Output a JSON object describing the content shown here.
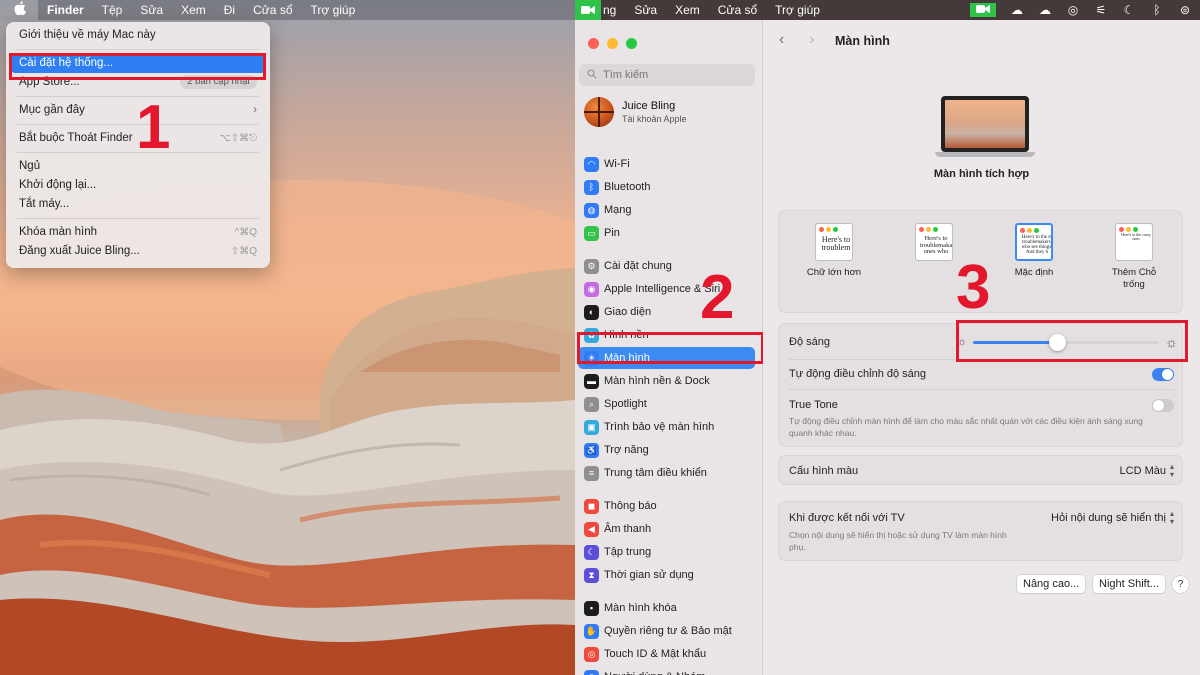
{
  "menubar_left": {
    "app_name": "Finder",
    "items": [
      "Tệp",
      "Sửa",
      "Xem",
      "Đi",
      "Cửa sổ",
      "Trợ giúp"
    ]
  },
  "menubar_right": {
    "items": [
      "ng",
      "Sửa",
      "Xem",
      "Cửa sổ",
      "Trợ giúp"
    ]
  },
  "apple_menu": {
    "about": "Giới thiệu về máy Mac này",
    "system_settings": "Cài đặt hệ thống...",
    "app_store": "App Store...",
    "app_store_badge": "2 bản cập nhật",
    "recent_items": "Mục gần đây",
    "force_quit": "Bắt buộc Thoát Finder",
    "force_quit_shortcut": "⌥⇧⌘⎋",
    "sleep": "Ngủ",
    "restart": "Khởi động lại...",
    "shut_down": "Tắt máy...",
    "lock_screen": "Khóa màn hình",
    "lock_screen_shortcut": "^⌘Q",
    "log_out": "Đăng xuất Juice Bling...",
    "log_out_shortcut": "⇧⌘Q"
  },
  "annotations": {
    "step1": "1",
    "step2": "2",
    "step3": "3"
  },
  "sidebar": {
    "search_placeholder": "Tìm kiếm",
    "account_name": "Juice Bling",
    "account_sub": "Tài khoản Apple",
    "items": [
      {
        "label": "Wi-Fi",
        "icon": "wifi-icon",
        "color": "#2f7cf6"
      },
      {
        "label": "Bluetooth",
        "icon": "bluetooth-icon",
        "color": "#2f7cf6"
      },
      {
        "label": "Mạng",
        "icon": "globe-icon",
        "color": "#2f7cf6"
      },
      {
        "label": "Pin",
        "icon": "battery-icon",
        "color": "#33c24d"
      },
      {
        "label": "Cài đặt chung",
        "icon": "gear-icon",
        "color": "#8e8e93"
      },
      {
        "label": "Apple Intelligence & Siri",
        "icon": "siri-icon",
        "color": "#c36be0"
      },
      {
        "label": "Giao diện",
        "icon": "appearance-icon",
        "color": "#1c1c1e"
      },
      {
        "label": "Hình nền",
        "icon": "wallpaper-icon",
        "color": "#34aadc"
      },
      {
        "label": "Màn hình",
        "icon": "display-icon",
        "color": "#2f7cf6"
      },
      {
        "label": "Màn hình nền & Dock",
        "icon": "dock-icon",
        "color": "#1c1c1e"
      },
      {
        "label": "Spotlight",
        "icon": "spotlight-icon",
        "color": "#8e8e93"
      },
      {
        "label": "Trình bảo vệ màn hình",
        "icon": "screensaver-icon",
        "color": "#34aadc"
      },
      {
        "label": "Trợ năng",
        "icon": "accessibility-icon",
        "color": "#2f7cf6"
      },
      {
        "label": "Trung tâm điều khiển",
        "icon": "control-center-icon",
        "color": "#8e8e93"
      },
      {
        "label": "Thông báo",
        "icon": "notification-icon",
        "color": "#f0493e"
      },
      {
        "label": "Âm thanh",
        "icon": "sound-icon",
        "color": "#f0493e"
      },
      {
        "label": "Tập trung",
        "icon": "focus-icon",
        "color": "#5b4fd9"
      },
      {
        "label": "Thời gian sử dụng",
        "icon": "hourglass-icon",
        "color": "#5b4fd9"
      },
      {
        "label": "Màn hình khóa",
        "icon": "lock-icon",
        "color": "#1c1c1e"
      },
      {
        "label": "Quyền riêng tư & Bảo mật",
        "icon": "hand-icon",
        "color": "#2f7cf6"
      },
      {
        "label": "Touch ID & Mật khẩu",
        "icon": "fingerprint-icon",
        "color": "#f0493e"
      },
      {
        "label": "Người dùng & Nhóm",
        "icon": "users-icon",
        "color": "#2f7cf6"
      }
    ]
  },
  "main": {
    "title": "Màn hình",
    "display_name": "Màn hình tích hợp",
    "resolution_options": [
      {
        "label": "Chữ lớn hơn",
        "preview": "Here's to troublem"
      },
      {
        "label": "",
        "preview": "Here's to troublemaka ones who"
      },
      {
        "label": "Mặc định",
        "preview": "Here's to the m troublemakers. who see things. And they h"
      },
      {
        "label": "Thêm Chỗ trống",
        "preview": "Here's to the crazy ones"
      }
    ],
    "brightness_label": "Độ sáng",
    "brightness_value": 0.45,
    "auto_brightness_label": "Tự động điều chỉnh độ sáng",
    "auto_brightness_on": true,
    "true_tone_label": "True Tone",
    "true_tone_desc": "Tự động điều chỉnh màn hình để làm cho màu sắc nhất quán với các điều kiện ánh sáng xung quanh khác nhau.",
    "true_tone_on": false,
    "color_profile_label": "Cấu hình màu",
    "color_profile_value": "LCD Màu",
    "tv_label": "Khi được kết nối với TV",
    "tv_value": "Hỏi nội dung sẽ hiển thị",
    "tv_desc": "Chọn nội dung sẽ hiển thị hoặc sử dụng TV làm màn hình phụ.",
    "advanced_button": "Nâng cao...",
    "night_shift_button": "Night Shift...",
    "help_button": "?"
  },
  "colors": {
    "accent": "#3b82f0",
    "annotation_red": "#e3182d"
  }
}
